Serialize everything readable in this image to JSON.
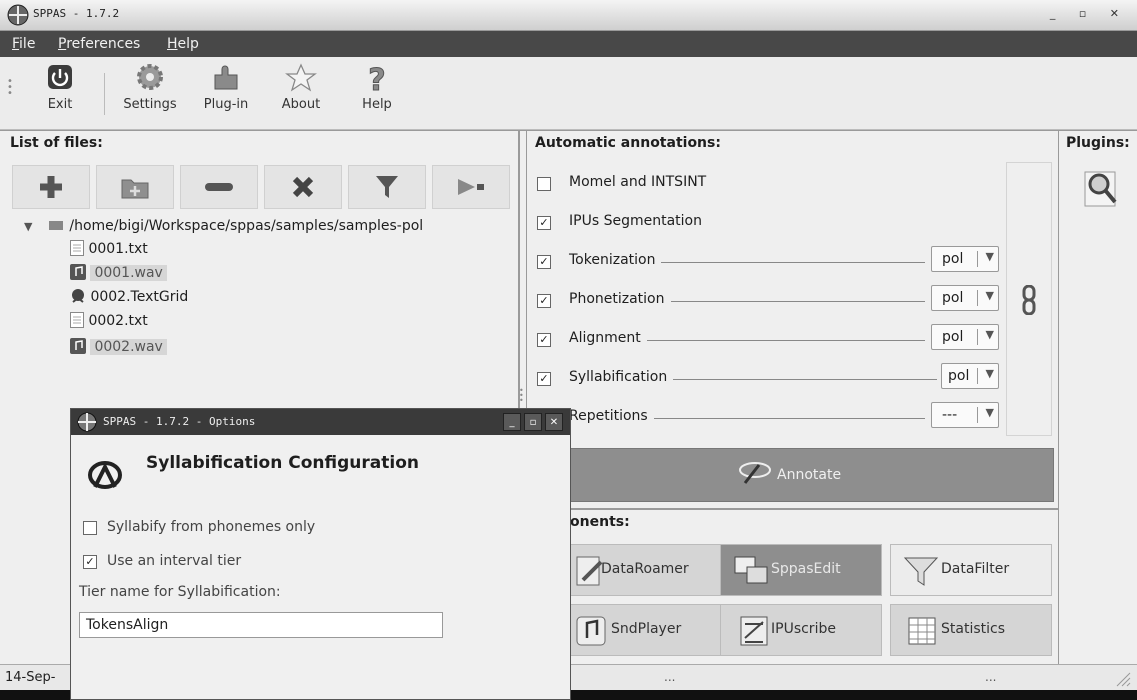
{
  "window": {
    "title": "SPPAS - 1.7.2"
  },
  "menubar": {
    "items": [
      {
        "label": "File",
        "accel": "F",
        "rest": "ile"
      },
      {
        "label": "Preferences",
        "accel": "P",
        "rest": "references"
      },
      {
        "label": "Help",
        "accel": "H",
        "rest": "elp"
      }
    ]
  },
  "toolbar": {
    "exit": "Exit",
    "settings": "Settings",
    "plugin": "Plug-in",
    "about": "About",
    "help": "Help"
  },
  "files": {
    "title": "List of files:",
    "root": "/home/bigi/Workspace/sppas/samples/samples-pol",
    "items": [
      {
        "name": "0001.txt",
        "type": "txt"
      },
      {
        "name": "0001.wav",
        "type": "wav"
      },
      {
        "name": "0002.TextGrid",
        "type": "textgrid"
      },
      {
        "name": "0002.txt",
        "type": "txt"
      },
      {
        "name": "0002.wav",
        "type": "wav"
      }
    ]
  },
  "annotations": {
    "title": "Automatic annotations:",
    "rows": [
      {
        "label": "Momel and INTSINT",
        "checked": false,
        "lang": ""
      },
      {
        "label": "IPUs Segmentation",
        "checked": true,
        "lang": ""
      },
      {
        "label": "Tokenization",
        "checked": true,
        "lang": "pol"
      },
      {
        "label": "Phonetization",
        "checked": true,
        "lang": "pol"
      },
      {
        "label": "Alignment",
        "checked": true,
        "lang": "pol"
      },
      {
        "label": "Syllabification",
        "checked": true,
        "lang": "pol"
      },
      {
        "label": "Repetitions",
        "checked": false,
        "lang": "---"
      }
    ],
    "annotate": "Annotate"
  },
  "plugins": {
    "title": "Plugins:"
  },
  "components": {
    "title": "ponents:",
    "items": [
      "DataRoamer",
      "SppasEdit",
      "DataFilter",
      "SndPlayer",
      "IPUscribe",
      "Statistics"
    ]
  },
  "status": {
    "left": "14-Sep-",
    "mid": "...",
    "right": "..."
  },
  "dialog": {
    "title": "SPPAS - 1.7.2 - Options",
    "heading": "Syllabification Configuration",
    "opt1": "Syllabify from phonemes only",
    "opt1_checked": false,
    "opt2": "Use an interval tier",
    "opt2_checked": true,
    "tier_label": "Tier name for Syllabification:",
    "tier_value": "TokensAlign"
  }
}
